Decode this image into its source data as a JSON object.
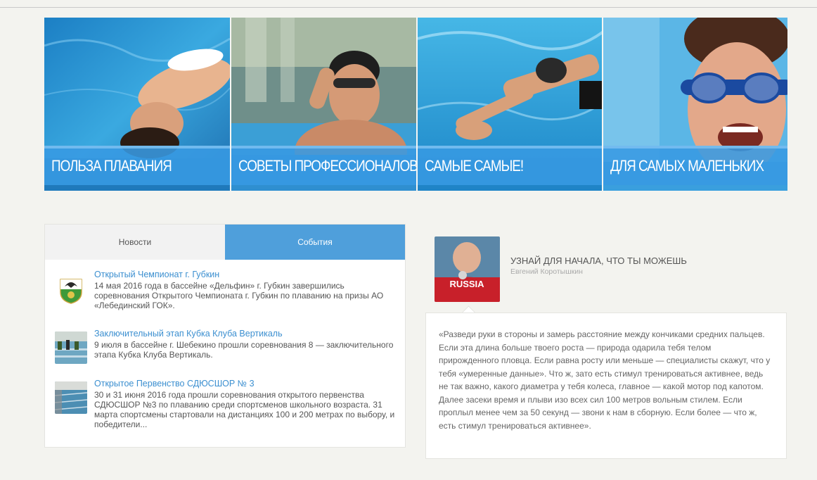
{
  "banner": {
    "tiles": [
      {
        "label": "ПОЛЬЗА ПЛАВАНИЯ"
      },
      {
        "label": "СОВЕТЫ ПРОФЕССИОНАЛОВ"
      },
      {
        "label": "САМЫЕ САМЫЕ!"
      },
      {
        "label": "ДЛЯ САМЫХ МАЛЕНЬКИХ"
      }
    ]
  },
  "news": {
    "tabs": [
      {
        "label": "Новости",
        "active": false
      },
      {
        "label": "События",
        "active": true
      }
    ],
    "items": [
      {
        "title": "Открытый Чемпионат г. Губкин",
        "text": "14 мая 2016 года в бассейне «Дельфин» г. Губкин завершились соревнования Открытого Чемпионата г. Губкин по плаванию на призы АО «Лебединский ГОК».",
        "thumb": "coat-of-arms-icon"
      },
      {
        "title": "Заключительный этап Кубка Клуба Вертикаль",
        "text": "9 июля в бассейне г. Шебекино прошли соревнования 8 — заключительного этапа Кубка Клуба Вертикаль.",
        "thumb": "pool-photo"
      },
      {
        "title": "Открытое Первенство СДЮСШОР № 3",
        "text": "30 и 31 июня 2016 года прошли соревнования открытого первенства СДЮСШОР №3 по плаванию среди спортсменов школьного возраста. 31 марта спортсмены стартовали на дистанциях 100 и 200 метрах по выбору, и победители...",
        "thumb": "pool-photo"
      }
    ]
  },
  "quote": {
    "title": "УЗНАЙ ДЛЯ НАЧАЛА, ЧТО ТЫ МОЖЕШЬ",
    "author": "Евгений Коротышкин",
    "avatar_text": "RUSSIA",
    "text": "«Разведи руки в стороны и замерь расстояние между кончиками средних пальцев. Если эта длина больше твоего роста — природа одарила тебя телом прирожденного пловца. Если равна росту или меньше — специалисты скажут, что у тебя «умеренные данные». Что ж, зато есть стимул тренироваться активнее, ведь не так важно, какого диаметра у тебя колеса, главное — какой мотор под капотом. Далее засеки время и плыви изо всех сил 100 метров вольным стилем. Если проплыл менее чем за 50 секунд — звони к нам в сборную. Если более — что ж, есть стимул тренироваться активнее»."
  },
  "colors": {
    "accent": "#4f9fdb",
    "link": "#3b8fd0",
    "caption_bg": "#389ae2",
    "page_bg": "#f3f3ef"
  }
}
